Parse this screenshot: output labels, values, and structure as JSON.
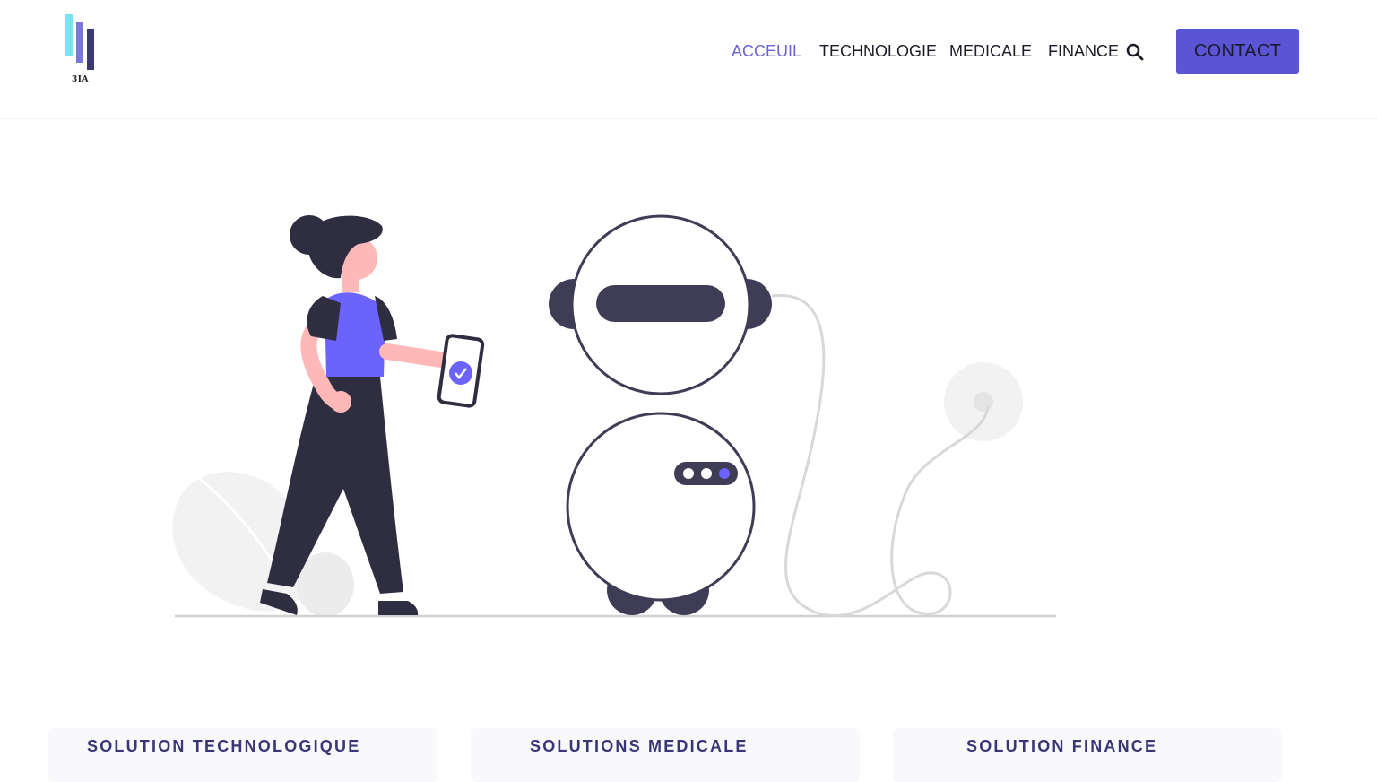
{
  "brand": {
    "logo_text": "3IA"
  },
  "nav": {
    "items": [
      {
        "label": "ACCEUIL",
        "active": true
      },
      {
        "label": "TECHNOLOGIE",
        "active": false
      },
      {
        "label": "MEDICALE",
        "active": false
      },
      {
        "label": "FINANCE",
        "active": false
      }
    ],
    "search_icon": "search-icon",
    "contact_label": "CONTACT"
  },
  "hero": {
    "illustration": "woman-with-phone-and-robot",
    "colors": {
      "accent": "#6c63ff",
      "dark": "#2f2e41",
      "skin": "#ffb8b8",
      "light_gray": "#f2f2f2"
    }
  },
  "cards": [
    {
      "title": "SOLUTION TECHNOLOGIQUE"
    },
    {
      "title": "SOLUTIONS MEDICALE"
    },
    {
      "title": "SOLUTION FINANCE"
    }
  ],
  "theme": {
    "accent": "#5b55d6",
    "active_nav": "#6b63d6",
    "text": "#1c1c28",
    "card_title": "#3a3575"
  }
}
